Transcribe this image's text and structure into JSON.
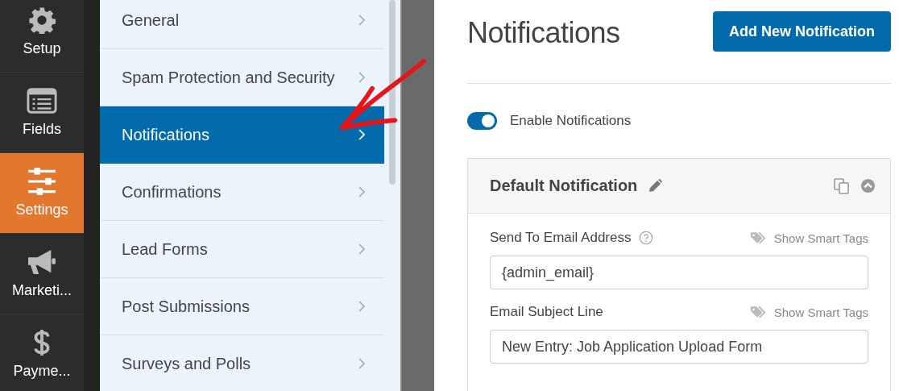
{
  "rail": [
    {
      "label": "Setup",
      "selected": false
    },
    {
      "label": "Fields",
      "selected": false
    },
    {
      "label": "Settings",
      "selected": true
    },
    {
      "label": "Marketi...",
      "selected": false
    },
    {
      "label": "Payme...",
      "selected": false
    }
  ],
  "settings_menu": [
    {
      "label": "General",
      "selected": false
    },
    {
      "label": "Spam Protection and Security",
      "selected": false
    },
    {
      "label": "Notifications",
      "selected": true
    },
    {
      "label": "Confirmations",
      "selected": false
    },
    {
      "label": "Lead Forms",
      "selected": false
    },
    {
      "label": "Post Submissions",
      "selected": false
    },
    {
      "label": "Surveys and Polls",
      "selected": false
    }
  ],
  "main": {
    "title": "Notifications",
    "add_button": "Add New Notification",
    "enable_toggle": {
      "label": "Enable Notifications",
      "on": true
    },
    "notification": {
      "title": "Default Notification",
      "expanded": true,
      "fields": [
        {
          "label": "Send To Email Address",
          "help": true,
          "smart_tags": "Show Smart Tags",
          "value": "{admin_email}"
        },
        {
          "label": "Email Subject Line",
          "help": false,
          "smart_tags": "Show Smart Tags",
          "value": "New Entry: Job Application Upload Form"
        }
      ]
    }
  }
}
